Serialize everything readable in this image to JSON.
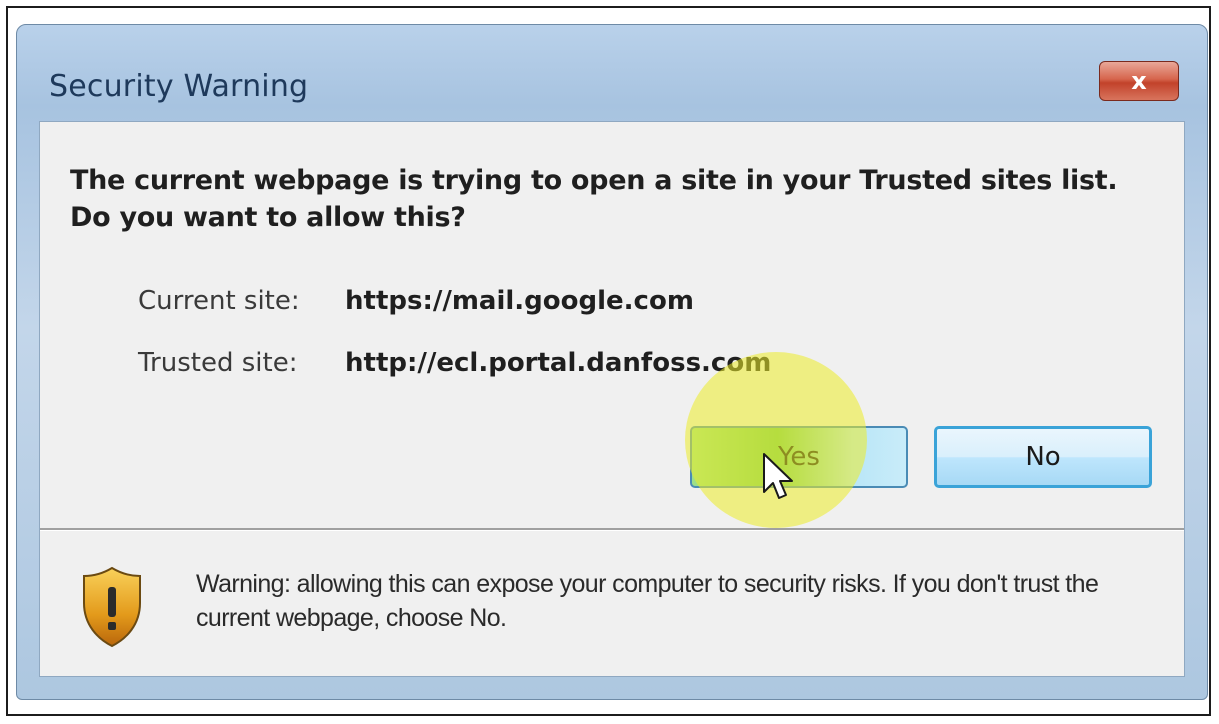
{
  "dialog": {
    "title": "Security Warning",
    "close_label": "x",
    "question_line1": "The current webpage is trying to open a site in your Trusted sites list.",
    "question_line2": "Do you want to allow this?",
    "current_site_label": "Current site:",
    "current_site_value": "https://mail.google.com",
    "trusted_site_label": "Trusted site:",
    "trusted_site_value": "http://ecl.portal.danfoss.com",
    "yes_label": "Yes",
    "no_label": "No",
    "warning_text": "Warning: allowing this can expose your computer to security risks. If you don't trust the current webpage, choose No."
  },
  "icons": {
    "close": "close-icon",
    "shield": "shield-warning-icon",
    "cursor": "mouse-cursor-icon"
  },
  "colors": {
    "highlight": "#ecec28",
    "yes_button_green": "#73c95a",
    "no_button_border": "#3aa3d8",
    "close_button_red": "#c2422a"
  }
}
